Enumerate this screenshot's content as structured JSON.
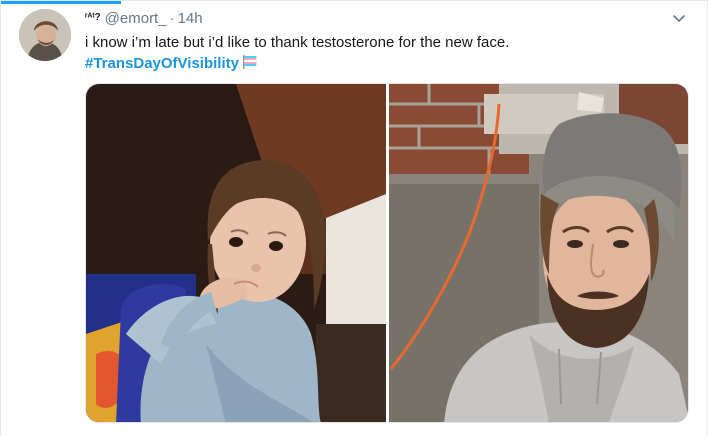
{
  "tweet": {
    "display_name": "ʳᴬᵗ?",
    "handle": "@emort_",
    "separator": "·",
    "time": "14h",
    "text": "i know i’m late but i’d like to thank testosterone for the new face.",
    "hashtag": "#TransDayOfVisibility",
    "flag_icon": "transgender-flag-emoji",
    "caret_icon": "chevron-down-icon"
  },
  "media": {
    "count": 2,
    "photos": [
      "toddler-childhood-photo",
      "bearded-man-in-beanie-selfie"
    ]
  },
  "colors": {
    "link": "#1b95e0",
    "accent": "#1da1f2",
    "secondary_text": "#657786",
    "border": "#e1e8ed"
  }
}
